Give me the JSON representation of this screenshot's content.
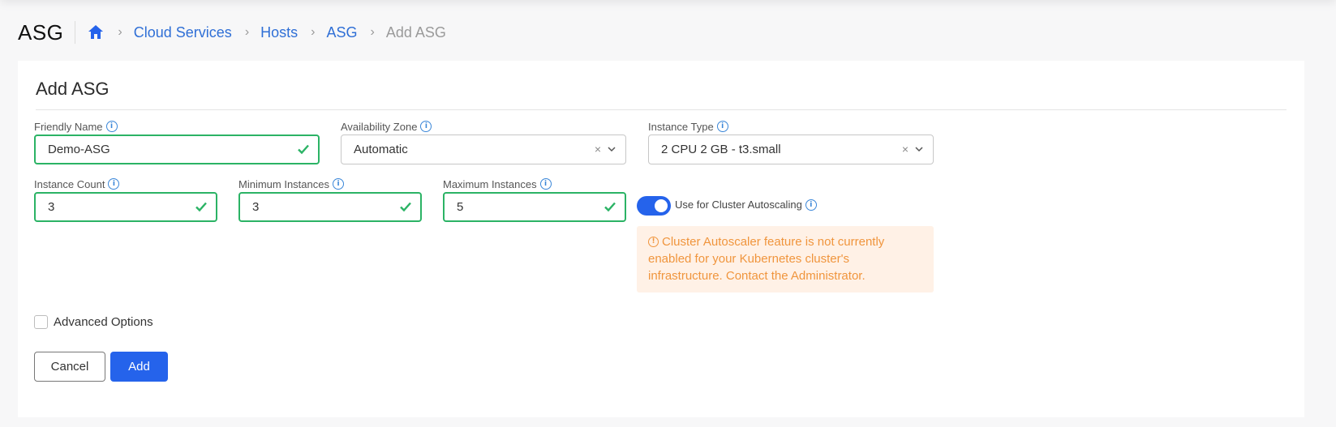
{
  "header": {
    "title": "ASG",
    "breadcrumb": [
      "Cloud Services",
      "Hosts",
      "ASG"
    ],
    "current": "Add ASG"
  },
  "form": {
    "title": "Add ASG",
    "friendly_name": {
      "label": "Friendly Name",
      "value": "Demo-ASG"
    },
    "availability_zone": {
      "label": "Availability Zone",
      "value": "Automatic"
    },
    "instance_type": {
      "label": "Instance Type",
      "value": "2 CPU 2 GB - t3.small"
    },
    "instance_count": {
      "label": "Instance Count",
      "value": "3"
    },
    "min_instances": {
      "label": "Minimum Instances",
      "value": "3"
    },
    "max_instances": {
      "label": "Maximum Instances",
      "value": "5"
    },
    "autoscaling": {
      "label": "Use for Cluster Autoscaling",
      "enabled": true
    },
    "warning": {
      "line1": "Cluster Autoscaler feature is not currently",
      "line2": "enabled for your Kubernetes cluster's",
      "line3": "infrastructure. Contact the Administrator."
    },
    "advanced_options": {
      "label": "Advanced Options",
      "checked": false
    },
    "cancel_label": "Cancel",
    "add_label": "Add"
  },
  "colors": {
    "accent": "#2563eb",
    "link": "#2f6fd6",
    "valid": "#2bb365",
    "warning_text": "#f0953d",
    "warning_bg": "#fff1e6"
  },
  "icons": [
    "home-icon",
    "chevron-right-icon",
    "info-icon",
    "check-icon",
    "clear-icon",
    "chevron-down-icon",
    "warning-icon"
  ]
}
